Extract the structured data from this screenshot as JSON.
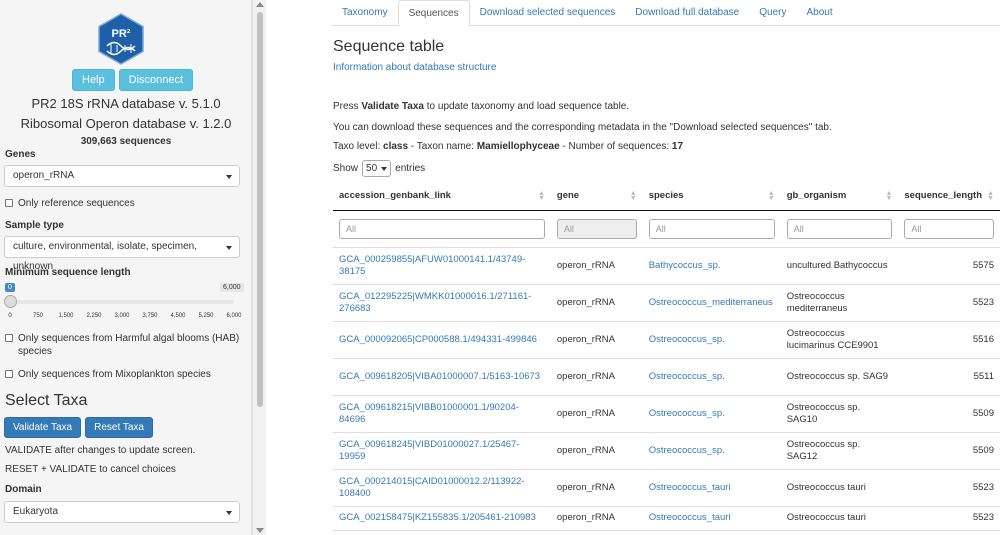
{
  "sidebar": {
    "logo_text": "PR²",
    "help_label": "Help",
    "disconnect_label": "Disconnect",
    "db_line1": "PR2 18S rRNA database v. 5.1.0",
    "db_line2": "Ribosomal Operon database v. 1.2.0",
    "seq_count": "309,663 sequences",
    "genes_label": "Genes",
    "genes_value": "operon_rRNA",
    "only_reference": "Only reference sequences",
    "sample_type_label": "Sample type",
    "sample_type_value": "culture, environmental, isolate, specimen, unknown",
    "min_length_label": "Minimum sequence length",
    "slider_min": "0",
    "slider_max": "6,000",
    "slider_ticks": [
      "0",
      "750",
      "1,500",
      "2,250",
      "3,000",
      "3,750",
      "4,500",
      "5,250",
      "6,000"
    ],
    "hab_label": "Only sequences from Harmful algal blooms (HAB) species",
    "mixo_label": "Only sequences from Mixoplankton species",
    "select_taxa_title": "Select Taxa",
    "validate_label": "Validate Taxa",
    "reset_label": "Reset Taxa",
    "validate_hint": "VALIDATE after changes to update screen.",
    "reset_hint": "RESET + VALIDATE to cancel choices",
    "domain_label": "Domain",
    "domain_value": "Eukaryota"
  },
  "tabs": [
    "Taxonomy",
    "Sequences",
    "Download selected sequences",
    "Download full database",
    "Query",
    "About"
  ],
  "main": {
    "title": "Sequence table",
    "info_link": "Information about database structure",
    "press_prefix": "Press ",
    "press_bold": "Validate Taxa",
    "press_suffix": " to update taxonomy and load sequence table.",
    "download_text": "You can download these sequences and the corresponding metadata in the \"Download selected sequences\" tab.",
    "taxo_prefix": "Taxo level: ",
    "taxo_level": "class",
    "taxon_prefix": " - Taxon name: ",
    "taxon_name": "Mamiellophyceae",
    "nseq_prefix": " - Number of sequences: ",
    "nseq": "17",
    "show_label": "Show",
    "show_value": "50",
    "entries_label": "entries"
  },
  "table": {
    "headers": [
      "accession_genbank_link",
      "gene",
      "species",
      "gb_organism",
      "sequence_length"
    ],
    "filter_placeholder": "All",
    "rows": [
      [
        "GCA_000259855|AFUW01000141.1/43749-38175",
        "operon_rRNA",
        "Bathycoccus_sp.",
        "uncultured Bathycoccus",
        "5575"
      ],
      [
        "GCA_012295225|WMKK01000016.1/271161-276683",
        "operon_rRNA",
        "Ostreococcus_mediterraneus",
        "Ostreococcus mediterraneus",
        "5523"
      ],
      [
        "GCA_000092065|CP000588.1/494331-499846",
        "operon_rRNA",
        "Ostreococcus_sp.",
        "Ostreococcus lucimarinus CCE9901",
        "5516"
      ],
      [
        "GCA_009618205|VIBA01000007.1/5163-10673",
        "operon_rRNA",
        "Ostreococcus_sp.",
        "Ostreococcus sp. SAG9",
        "5511"
      ],
      [
        "GCA_009618215|VIBB01000001.1/90204-84696",
        "operon_rRNA",
        "Ostreococcus_sp.",
        "Ostreococcus sp. SAG10",
        "5509"
      ],
      [
        "GCA_009618245|VIBD01000027.1/25467-19959",
        "operon_rRNA",
        "Ostreococcus_sp.",
        "Ostreococcus sp. SAG12",
        "5509"
      ],
      [
        "GCA_000214015|CAID01000012.2/113922-108400",
        "operon_rRNA",
        "Ostreococcus_tauri",
        "Ostreococcus tauri",
        "5523"
      ],
      [
        "GCA_002158475|KZ155835.1/205461-210983",
        "operon_rRNA",
        "Ostreococcus_tauri",
        "Ostreococcus tauri",
        "5523"
      ]
    ]
  },
  "colors": {
    "link": "#337ab7",
    "info_button": "#5bc0de",
    "primary_button": "#337ab7"
  }
}
